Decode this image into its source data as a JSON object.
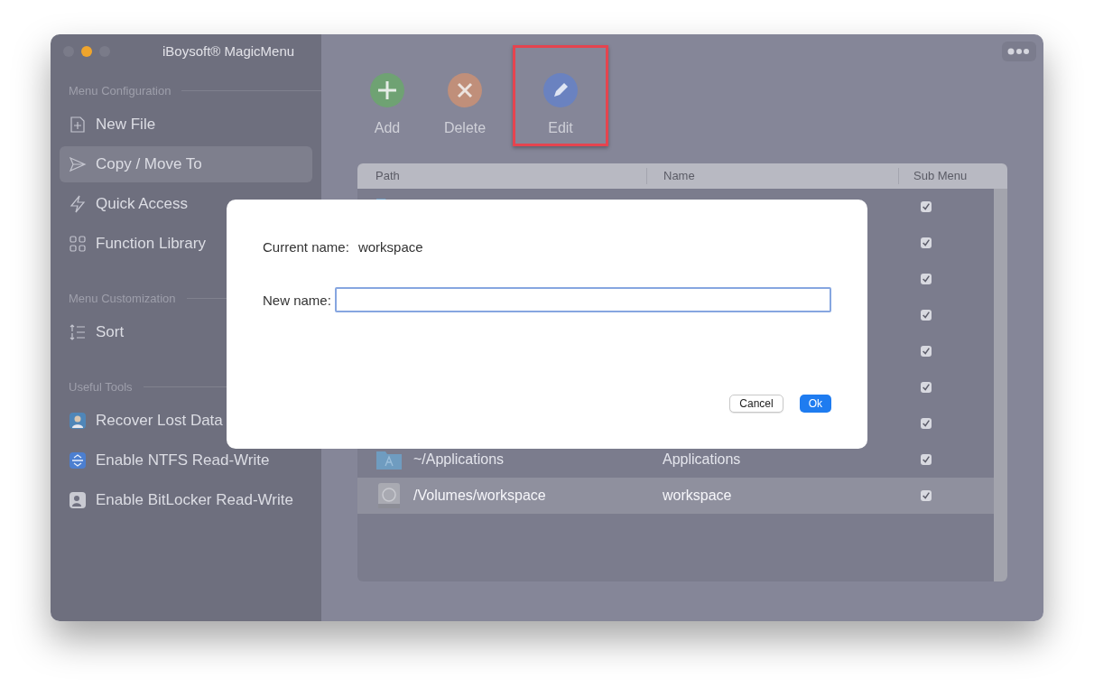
{
  "window": {
    "title": "iBoysoft® MagicMenu",
    "traffic_lights": [
      {
        "color": "#7a7b89"
      },
      {
        "color": "#f0a52c"
      },
      {
        "color": "#7a7b89"
      }
    ]
  },
  "sidebar": {
    "sections": [
      {
        "heading": "Menu Configuration",
        "items": [
          {
            "kind": "new-file",
            "label": "New File",
            "selected": false
          },
          {
            "kind": "copy",
            "label": "Copy / Move To",
            "selected": true
          },
          {
            "kind": "quick",
            "label": "Quick Access",
            "selected": false
          },
          {
            "kind": "library",
            "label": "Function Library",
            "selected": false
          }
        ]
      },
      {
        "heading": "Menu Customization",
        "items": [
          {
            "kind": "sort",
            "label": "Sort",
            "selected": false
          }
        ]
      },
      {
        "heading": "Useful Tools",
        "items": [
          {
            "kind": "recover",
            "label": "Recover Lost Data",
            "selected": false
          },
          {
            "kind": "ntfs",
            "label": "Enable NTFS Read-Write",
            "selected": false
          },
          {
            "kind": "bitlocker",
            "label": "Enable BitLocker Read-Write",
            "selected": false
          }
        ]
      }
    ]
  },
  "toolbar": [
    {
      "kind": "add",
      "label": "Add",
      "highlighted": false
    },
    {
      "kind": "delete",
      "label": "Delete",
      "highlighted": false
    },
    {
      "kind": "edit",
      "label": "Edit",
      "highlighted": true
    }
  ],
  "table": {
    "columns": [
      "Path",
      "Name",
      "Sub Menu"
    ],
    "rows": [
      {
        "kind": "folder",
        "sub_menu": true,
        "selected": false
      },
      {
        "sub_menu": true,
        "selected": false
      },
      {
        "sub_menu": true,
        "selected": false
      },
      {
        "sub_menu": true,
        "selected": false
      },
      {
        "sub_menu": true,
        "selected": false
      },
      {
        "sub_menu": true,
        "selected": false
      },
      {
        "sub_menu": true,
        "selected": false
      },
      {
        "kind": "app-folder",
        "path": "~/Applications",
        "name": "Applications",
        "sub_menu": true,
        "selected": false
      },
      {
        "kind": "disk",
        "path": "/Volumes/workspace",
        "name": "workspace",
        "sub_menu": true,
        "selected": true
      }
    ]
  },
  "dialog": {
    "current_label": "Current name:",
    "current_value": "workspace",
    "new_label": "New name:",
    "buttons": [
      {
        "kind": "secondary",
        "label": "Cancel"
      },
      {
        "kind": "primary",
        "label": "Ok"
      }
    ]
  }
}
